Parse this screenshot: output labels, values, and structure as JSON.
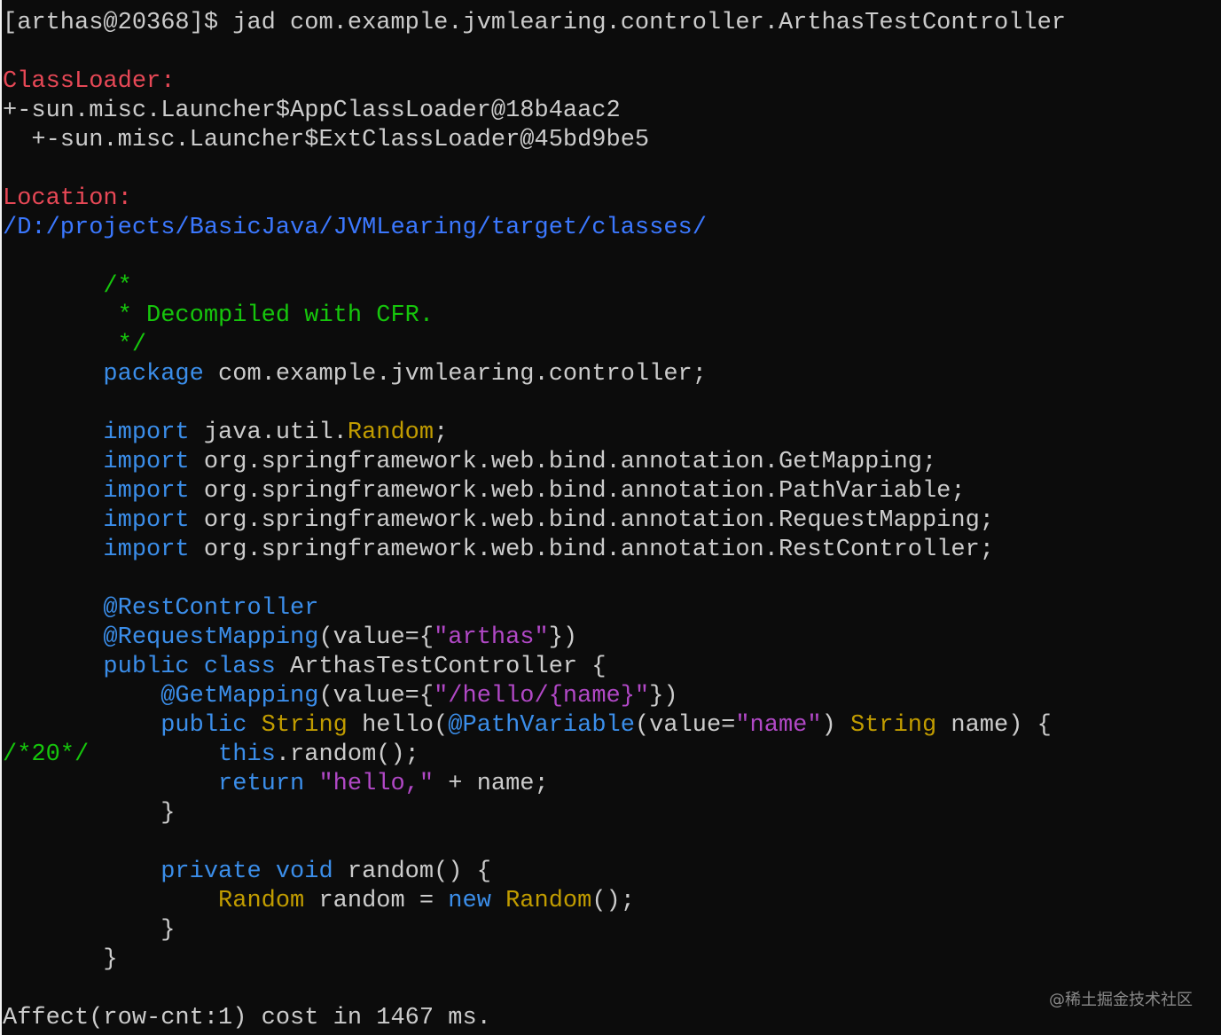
{
  "prompt": {
    "prefix": "[arthas@20368]$ ",
    "command": "jad com.example.jvmlearing.controller.ArthasTestController"
  },
  "classloader": {
    "label": "ClassLoader:",
    "line1": "+-sun.misc.Launcher$AppClassLoader@18b4aac2",
    "line2": "  +-sun.misc.Launcher$ExtClassLoader@45bd9be5"
  },
  "location": {
    "label": "Location:",
    "path": "/D:/projects/BasicJava/JVMLearing/target/classes/"
  },
  "code": {
    "comment_open": "/*",
    "comment_body": " * Decompiled with CFR.",
    "comment_close": " */",
    "kw_package": "package",
    "package_name": " com.example.jvmlearing.controller;",
    "kw_import": "import",
    "import1_pre": " java.util.",
    "import1_cls": "Random",
    "import1_post": ";",
    "import2": " org.springframework.web.bind.annotation.GetMapping;",
    "import3": " org.springframework.web.bind.annotation.PathVariable;",
    "import4": " org.springframework.web.bind.annotation.RequestMapping;",
    "import5": " org.springframework.web.bind.annotation.RestController;",
    "ann_rest": "@RestController",
    "ann_reqmap": "@RequestMapping",
    "reqmap_pre": "(value={",
    "reqmap_str": "\"arthas\"",
    "reqmap_post": "})",
    "kw_public": "public",
    "kw_class": "class",
    "class_name": " ArthasTestController {",
    "ann_getmap": "@GetMapping",
    "getmap_pre": "(value={",
    "getmap_str": "\"/hello/{name}\"",
    "getmap_post": "})",
    "type_string": "String",
    "method_hello": " hello(",
    "ann_pathvar": "@PathVariable",
    "pathvar_pre": "(value=",
    "pathvar_str": "\"name\"",
    "pathvar_post": ") ",
    "param_name": " name) {",
    "line_marker": "/*20*/",
    "kw_this": "this",
    "call_random": ".random();",
    "kw_return": "return",
    "return_str": "\"hello,\"",
    "return_post": " + name;",
    "brace_close": "}",
    "kw_private": "private",
    "kw_void": "void",
    "method_random": " random() {",
    "type_random": "Random",
    "var_random": " random = ",
    "kw_new": "new",
    "new_random_post": "();"
  },
  "result": {
    "text": "Affect(row-cnt:1) cost in 1467 ms."
  },
  "watermark": "@稀土掘金技术社区"
}
